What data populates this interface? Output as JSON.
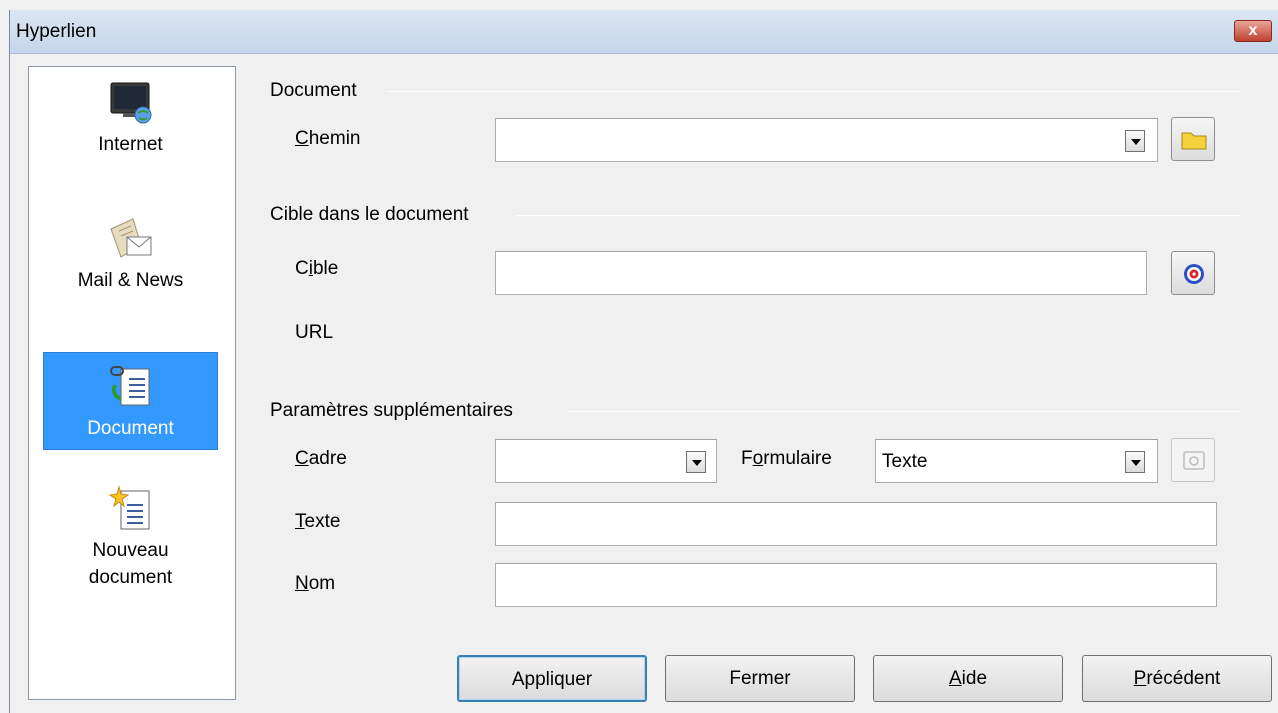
{
  "window": {
    "title": "Hyperlien",
    "close_label": "x"
  },
  "sidebar": {
    "items": [
      {
        "label": "Internet",
        "icon": "internet-monitor-icon",
        "selected": false
      },
      {
        "label": "Mail & News",
        "icon": "mail-news-icon",
        "selected": false
      },
      {
        "label": "Document",
        "icon": "document-link-icon",
        "selected": true
      },
      {
        "label": "Nouveau document",
        "label_line1": "Nouveau",
        "label_line2": "document",
        "icon": "new-document-icon",
        "selected": false
      }
    ]
  },
  "document_section": {
    "title": "Document",
    "path_label_mnemonic": "C",
    "path_label_rest": "hemin",
    "path_value": "",
    "open_file_icon": "folder-icon"
  },
  "target_section": {
    "title": "Cible dans le document",
    "target_label_pre": "C",
    "target_label_mnemonic": "i",
    "target_label_rest": "ble",
    "target_value": "",
    "target_icon": "target-icon",
    "url_label": "URL"
  },
  "extra_section": {
    "title": "Paramètres supplémentaires",
    "frame_label_mnemonic": "C",
    "frame_label_rest": "adre",
    "frame_value": "",
    "form_label_pre": "F",
    "form_label_mnemonic": "o",
    "form_label_rest": "rmulaire",
    "form_value": "Texte",
    "events_icon": "macro-events-icon",
    "text_label_mnemonic": "T",
    "text_label_rest": "exte",
    "text_value": "",
    "name_label_mnemonic": "N",
    "name_label_rest": "om",
    "name_value": ""
  },
  "buttons": {
    "apply": "Appliquer",
    "close": "Fermer",
    "help_mnemonic": "A",
    "help_rest": "ide",
    "back_mnemonic": "P",
    "back_rest": "récédent"
  }
}
